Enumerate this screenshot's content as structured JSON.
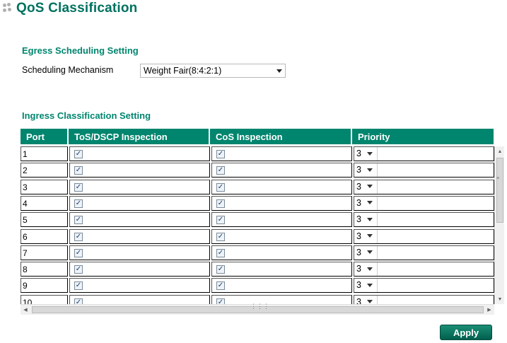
{
  "page": {
    "title": "QoS Classification"
  },
  "egress": {
    "heading": "Egress Scheduling Setting",
    "scheduling_label": "Scheduling Mechanism",
    "scheduling_value": "Weight Fair(8:4:2:1)"
  },
  "ingress": {
    "heading": "Ingress Classification Setting",
    "columns": [
      "Port",
      "ToS/DSCP Inspection",
      "CoS Inspection",
      "Priority"
    ],
    "rows": [
      {
        "port": "1",
        "tos_checked": true,
        "cos_checked": true,
        "priority": "3"
      },
      {
        "port": "2",
        "tos_checked": true,
        "cos_checked": true,
        "priority": "3"
      },
      {
        "port": "3",
        "tos_checked": true,
        "cos_checked": true,
        "priority": "3"
      },
      {
        "port": "4",
        "tos_checked": true,
        "cos_checked": true,
        "priority": "3"
      },
      {
        "port": "5",
        "tos_checked": true,
        "cos_checked": true,
        "priority": "3"
      },
      {
        "port": "6",
        "tos_checked": true,
        "cos_checked": true,
        "priority": "3"
      },
      {
        "port": "7",
        "tos_checked": true,
        "cos_checked": true,
        "priority": "3"
      },
      {
        "port": "8",
        "tos_checked": true,
        "cos_checked": true,
        "priority": "3"
      },
      {
        "port": "9",
        "tos_checked": true,
        "cos_checked": true,
        "priority": "3"
      },
      {
        "port": "10",
        "tos_checked": true,
        "cos_checked": true,
        "priority": "3"
      }
    ]
  },
  "actions": {
    "apply_label": "Apply"
  },
  "colors": {
    "accent": "#00856e",
    "title": "#00715f"
  },
  "icons": {
    "title": "dots-icon",
    "dropdown": "chevron-down-icon",
    "checkbox": "checkmark-icon"
  }
}
